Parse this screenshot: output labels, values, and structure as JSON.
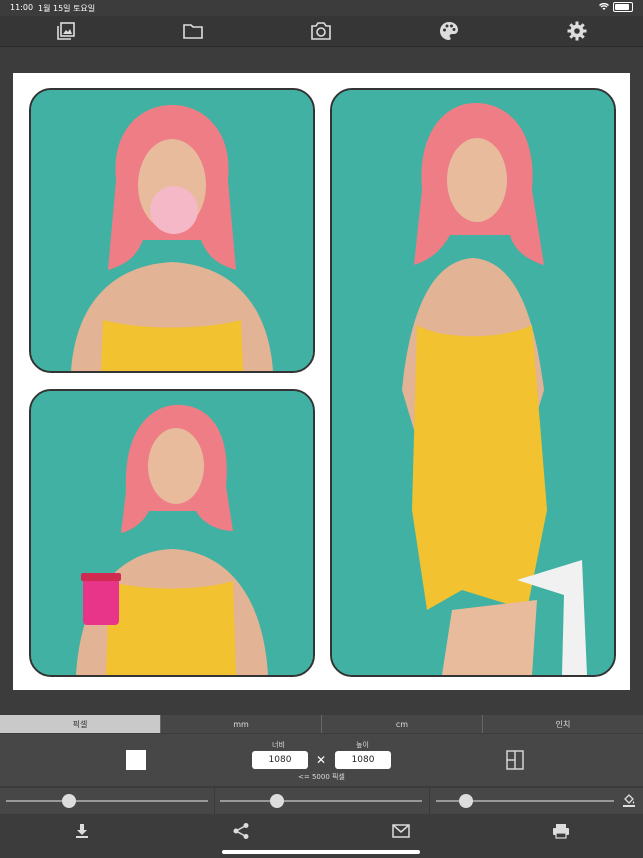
{
  "status": {
    "time": "11:00",
    "date": "1월 15일 토요일"
  },
  "toolbar": {
    "icons": [
      "gallery-icon",
      "folder-icon",
      "camera-icon",
      "palette-icon",
      "gear-icon"
    ]
  },
  "tabs": [
    {
      "label": "픽셀",
      "active": true
    },
    {
      "label": "mm",
      "active": false
    },
    {
      "label": "cm",
      "active": false
    },
    {
      "label": "인치",
      "active": false
    }
  ],
  "size": {
    "width_label": "너비",
    "height_label": "높이",
    "width_value": "1080",
    "height_value": "1080",
    "times": "✕",
    "limit": "<= 5000 픽셀"
  },
  "sliders": [
    {
      "name": "slider-1",
      "value": 0.31
    },
    {
      "name": "slider-2",
      "value": 0.28
    },
    {
      "name": "slider-3",
      "value": 0.19
    }
  ],
  "colors": {
    "accent_bg": "#3fb0a2",
    "toolbar": "#363636",
    "panel": "#474747"
  }
}
